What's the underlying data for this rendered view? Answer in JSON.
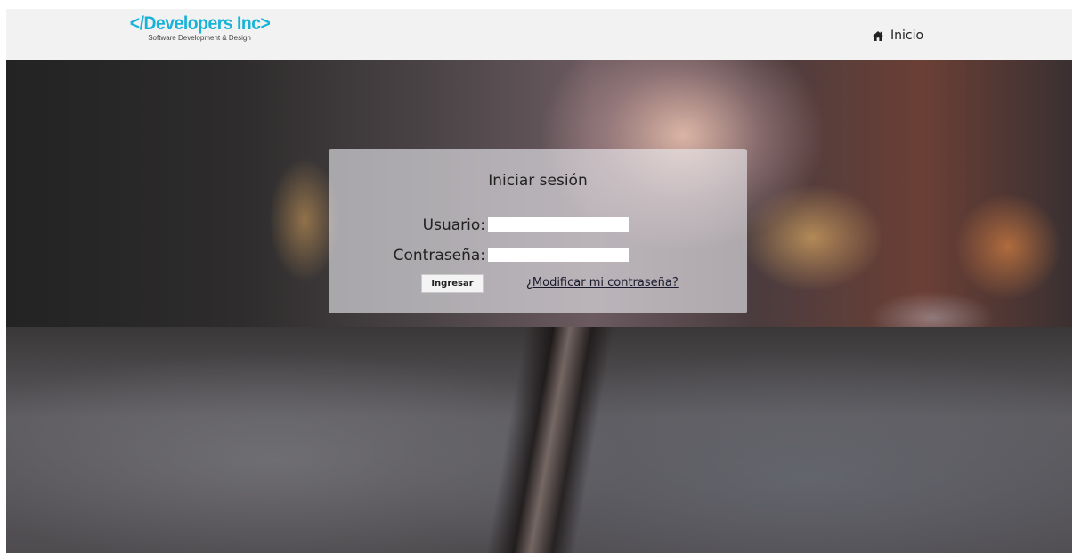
{
  "header": {
    "brand_name": "</Developers Inc>",
    "brand_tagline": "Software Development & Design",
    "nav_home_icon": "home-icon",
    "nav_home_label": "Inicio"
  },
  "login": {
    "title": "Iniciar sesión",
    "username_label": "Usuario:",
    "username_value": "",
    "password_label": "Contraseña:",
    "password_value": "",
    "submit_label": "Ingresar",
    "change_password_link": "¿Modificar mi contraseña?"
  },
  "colors": {
    "brand": "#18b3d8",
    "header_background": "#f2f2f2"
  }
}
